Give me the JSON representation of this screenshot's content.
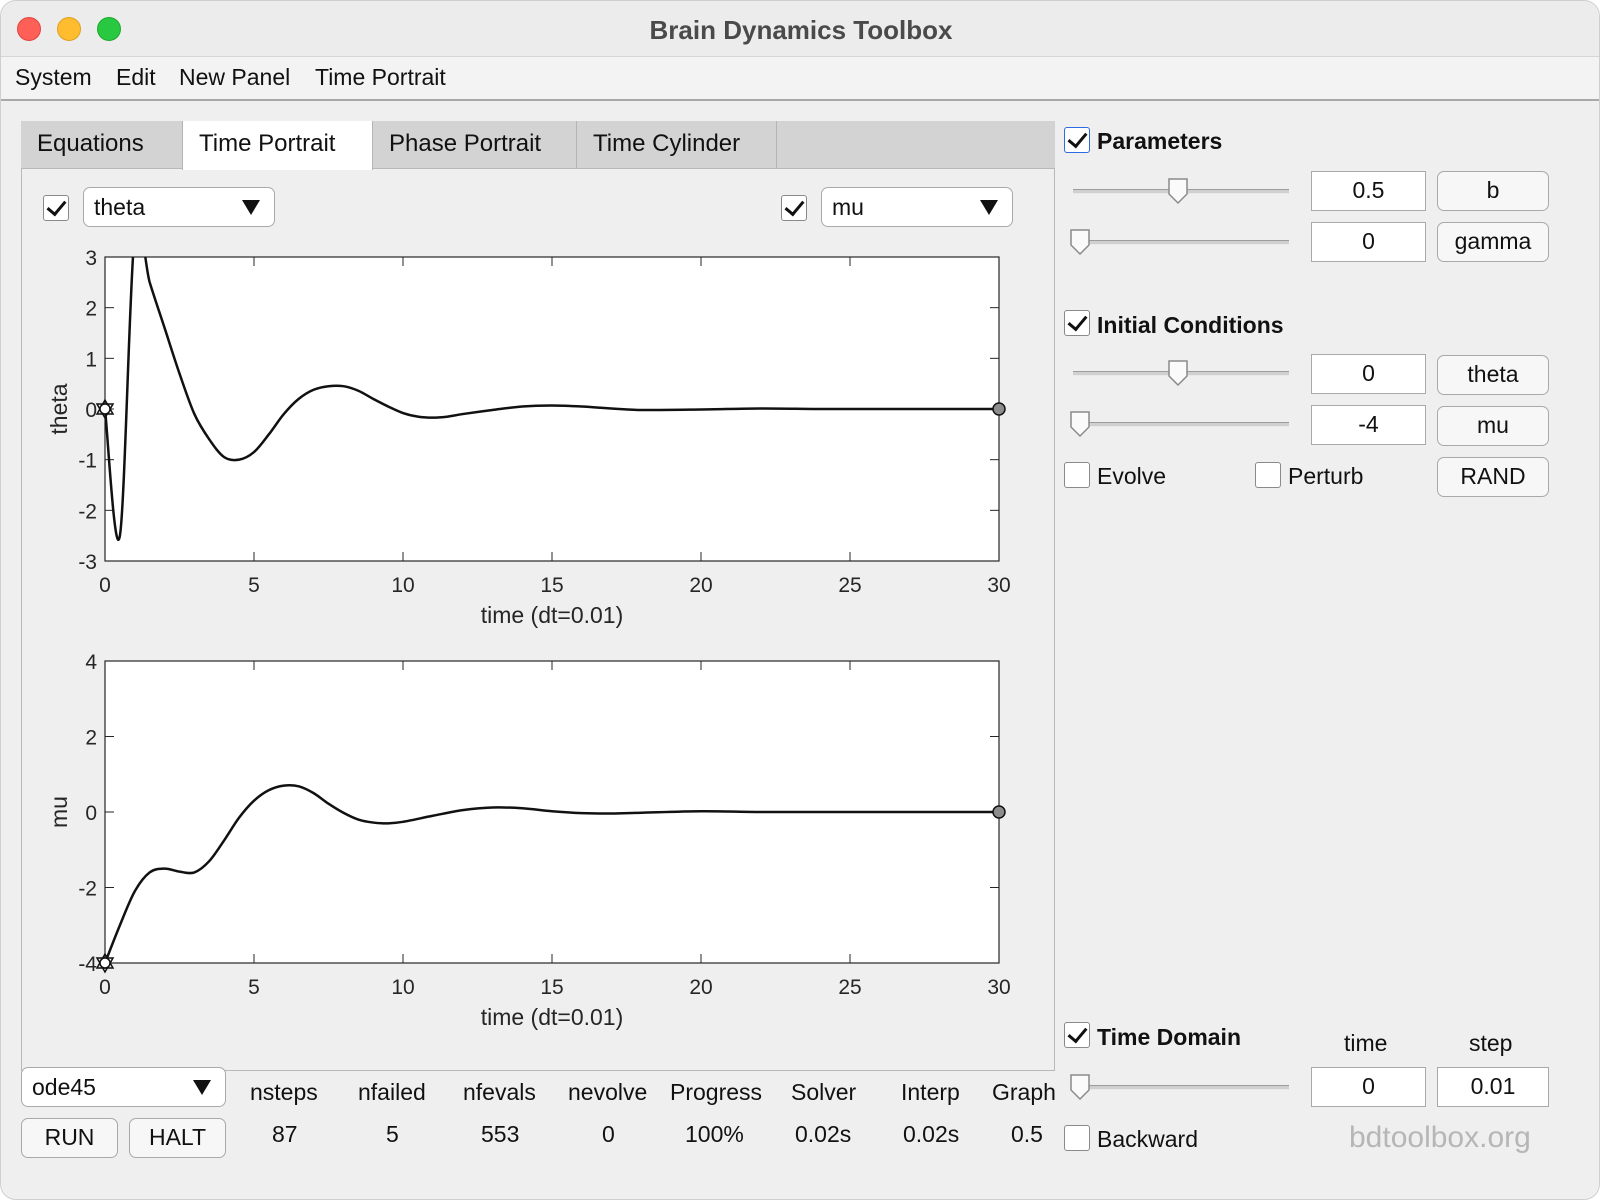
{
  "window": {
    "title": "Brain Dynamics Toolbox"
  },
  "menu": [
    "System",
    "Edit",
    "New Panel",
    "Time Portrait"
  ],
  "tabs": [
    "Equations",
    "Time Portrait",
    "Phase Portrait",
    "Time Cylinder"
  ],
  "active_tab": "Time Portrait",
  "left_selector": {
    "checked": true,
    "value": "theta"
  },
  "right_selector": {
    "checked": true,
    "value": "mu"
  },
  "chart_data": [
    {
      "type": "line",
      "xlabel": "time (dt=0.01)",
      "ylabel": "theta",
      "xlim": [
        0,
        30
      ],
      "ylim": [
        -3,
        3
      ],
      "xticks": [
        0,
        5,
        10,
        15,
        20,
        25,
        30
      ],
      "yticks": [
        3,
        2,
        1,
        0,
        -1,
        -2,
        -3
      ],
      "grid": false,
      "series": [
        {
          "x": [
            0,
            0.5,
            1,
            1.5,
            2,
            2.5,
            3,
            3.5,
            4,
            4.5,
            5,
            5.5,
            6,
            6.5,
            7,
            7.5,
            8,
            8.5,
            9,
            9.5,
            10,
            10.5,
            11,
            11.5,
            12,
            13,
            14,
            15,
            16,
            17,
            18,
            20,
            22,
            24,
            26,
            28,
            30
          ],
          "y": [
            0,
            -2.5,
            3.5,
            2.5,
            1.6,
            0.7,
            -0.1,
            -0.6,
            -0.95,
            -1.0,
            -0.85,
            -0.5,
            -0.1,
            0.2,
            0.38,
            0.45,
            0.45,
            0.36,
            0.2,
            0.05,
            -0.08,
            -0.15,
            -0.17,
            -0.15,
            -0.1,
            -0.02,
            0.05,
            0.07,
            0.05,
            0.01,
            -0.02,
            -0.01,
            0.01,
            0.0,
            0.0,
            0.0,
            0.0
          ]
        }
      ],
      "start_marker": {
        "x": 0,
        "y": 0
      },
      "end_marker": {
        "x": 30,
        "y": 0
      }
    },
    {
      "type": "line",
      "xlabel": "time (dt=0.01)",
      "ylabel": "mu",
      "xlim": [
        0,
        30
      ],
      "ylim": [
        -4,
        4
      ],
      "xticks": [
        0,
        5,
        10,
        15,
        20,
        25,
        30
      ],
      "yticks": [
        4,
        2,
        0,
        -2,
        -4
      ],
      "grid": false,
      "series": [
        {
          "x": [
            0,
            0.5,
            1,
            1.5,
            2,
            2.5,
            3,
            3.5,
            4,
            4.5,
            5,
            5.5,
            6,
            6.5,
            7,
            7.5,
            8,
            8.5,
            9,
            9.5,
            10,
            11,
            12,
            13,
            14,
            15,
            16,
            17,
            18,
            20,
            22,
            24,
            26,
            28,
            30
          ],
          "y": [
            -4,
            -3.0,
            -2.1,
            -1.6,
            -1.5,
            -1.58,
            -1.6,
            -1.3,
            -0.75,
            -0.15,
            0.3,
            0.58,
            0.7,
            0.68,
            0.5,
            0.22,
            -0.02,
            -0.2,
            -0.28,
            -0.3,
            -0.26,
            -0.1,
            0.05,
            0.12,
            0.1,
            0.02,
            -0.03,
            -0.04,
            -0.02,
            0.02,
            0.0,
            0.0,
            0.0,
            0.0,
            0.0
          ]
        }
      ],
      "start_marker": {
        "x": 0,
        "y": -4
      },
      "end_marker": {
        "x": 30,
        "y": 0
      }
    }
  ],
  "parameters": {
    "title": "Parameters",
    "checked": true,
    "rows": [
      {
        "value": "0.5",
        "name": "b",
        "slider": 0.5
      },
      {
        "value": "0",
        "name": "gamma",
        "slider": 0.0
      }
    ]
  },
  "initial_conditions": {
    "title": "Initial Conditions",
    "checked": true,
    "rows": [
      {
        "value": "0",
        "name": "theta",
        "slider": 0.5
      },
      {
        "value": "-4",
        "name": "mu",
        "slider": 0.0
      }
    ],
    "evolve_label": "Evolve",
    "evolve_checked": false,
    "perturb_label": "Perturb",
    "perturb_checked": false,
    "rand_label": "RAND"
  },
  "time_domain": {
    "title": "Time Domain",
    "checked": true,
    "time_header": "time",
    "step_header": "step",
    "time_value": "0",
    "step_value": "0.01",
    "slider": 0.0,
    "backward_label": "Backward",
    "backward_checked": false
  },
  "solver": {
    "value": "ode45",
    "run_label": "RUN",
    "halt_label": "HALT"
  },
  "stats": {
    "headers": [
      "nsteps",
      "nfailed",
      "nfevals",
      "nevolve",
      "Progress",
      "Solver",
      "Interp",
      "Graph"
    ],
    "values": [
      "87",
      "5",
      "553",
      "0",
      "100%",
      "0.02s",
      "0.02s",
      "0.5"
    ]
  },
  "watermark": "bdtoolbox.org"
}
